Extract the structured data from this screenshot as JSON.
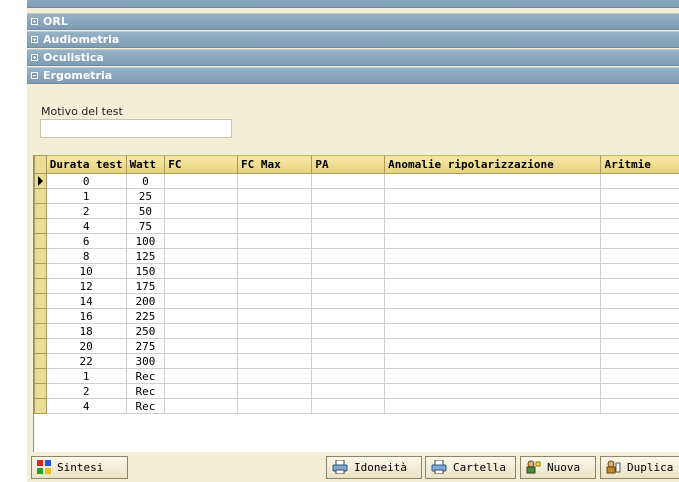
{
  "sections": [
    {
      "label": "ORL",
      "expanded": false
    },
    {
      "label": "Audiometria",
      "expanded": false
    },
    {
      "label": "Oculistica",
      "expanded": false
    },
    {
      "label": "Ergometria",
      "expanded": true
    }
  ],
  "ergometria": {
    "motivo_label": "Motivo del test",
    "motivo_value": ""
  },
  "table": {
    "columns": [
      "Durata test",
      "Watt",
      "FC",
      "FC Max",
      "PA",
      "Anomalie ripolarizzazione",
      "Aritmie"
    ],
    "rows": [
      [
        "0",
        "0"
      ],
      [
        "1",
        "25"
      ],
      [
        "2",
        "50"
      ],
      [
        "4",
        "75"
      ],
      [
        "6",
        "100"
      ],
      [
        "8",
        "125"
      ],
      [
        "10",
        "150"
      ],
      [
        "12",
        "175"
      ],
      [
        "14",
        "200"
      ],
      [
        "16",
        "225"
      ],
      [
        "18",
        "250"
      ],
      [
        "20",
        "275"
      ],
      [
        "22",
        "300"
      ],
      [
        "1",
        "Rec"
      ],
      [
        "2",
        "Rec"
      ],
      [
        "4",
        "Rec"
      ]
    ],
    "selected_row": 0
  },
  "buttons": {
    "sintesi": "Sintesi",
    "idoneita": "Idoneità",
    "cartella": "Cartella",
    "nuova": "Nuova",
    "duplica": "Duplica"
  },
  "colors": {
    "section_header": "#7f9cb3",
    "panel_bg": "#f3efd7",
    "grid_header": "#e7d27a"
  }
}
